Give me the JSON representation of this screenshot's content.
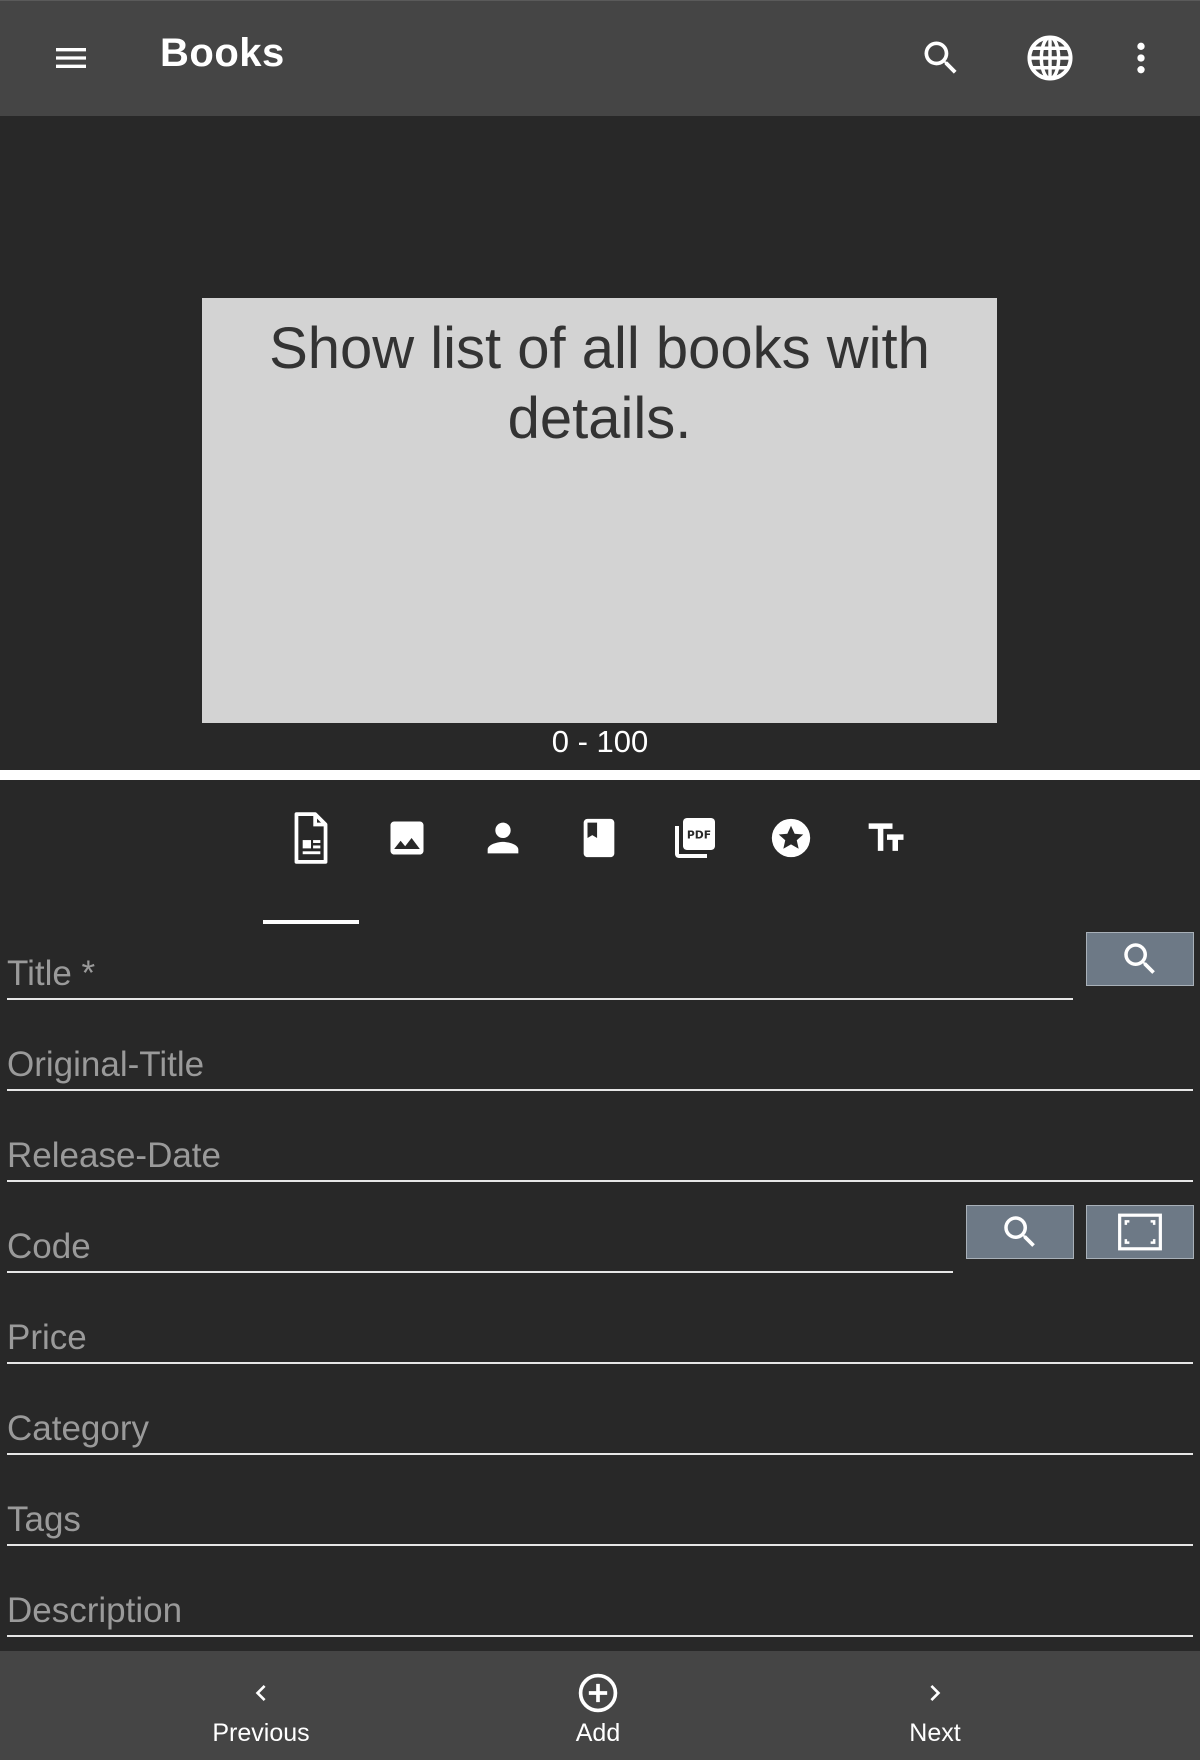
{
  "app": {
    "title": "Books"
  },
  "header": {
    "icons": [
      "menu-icon",
      "search-icon",
      "globe-icon",
      "more-vert-icon"
    ]
  },
  "preview": {
    "message": "Show list of all books with details.",
    "range": "0 - 100"
  },
  "tabs": [
    {
      "icon": "document-icon",
      "selected": true
    },
    {
      "icon": "image-icon",
      "selected": false
    },
    {
      "icon": "person-icon",
      "selected": false
    },
    {
      "icon": "book-icon",
      "selected": false
    },
    {
      "icon": "pdf-icon",
      "selected": false
    },
    {
      "icon": "star-icon",
      "selected": false
    },
    {
      "icon": "text-size-icon",
      "selected": false
    }
  ],
  "form": {
    "title": {
      "placeholder": "Title *",
      "value": ""
    },
    "original_title": {
      "placeholder": "Original-Title",
      "value": ""
    },
    "release_date": {
      "placeholder": "Release-Date",
      "value": ""
    },
    "code": {
      "placeholder": "Code",
      "value": ""
    },
    "price": {
      "placeholder": "Price",
      "value": ""
    },
    "category": {
      "placeholder": "Category",
      "value": ""
    },
    "tags": {
      "placeholder": "Tags",
      "value": ""
    },
    "description": {
      "placeholder": "Description",
      "value": ""
    }
  },
  "bottom_nav": {
    "previous": "Previous",
    "add": "Add",
    "next": "Next"
  },
  "colors": {
    "appbar": "#454545",
    "background": "#282828",
    "placeholder_box": "#d3d3d3",
    "side_button": "#6d7986"
  }
}
